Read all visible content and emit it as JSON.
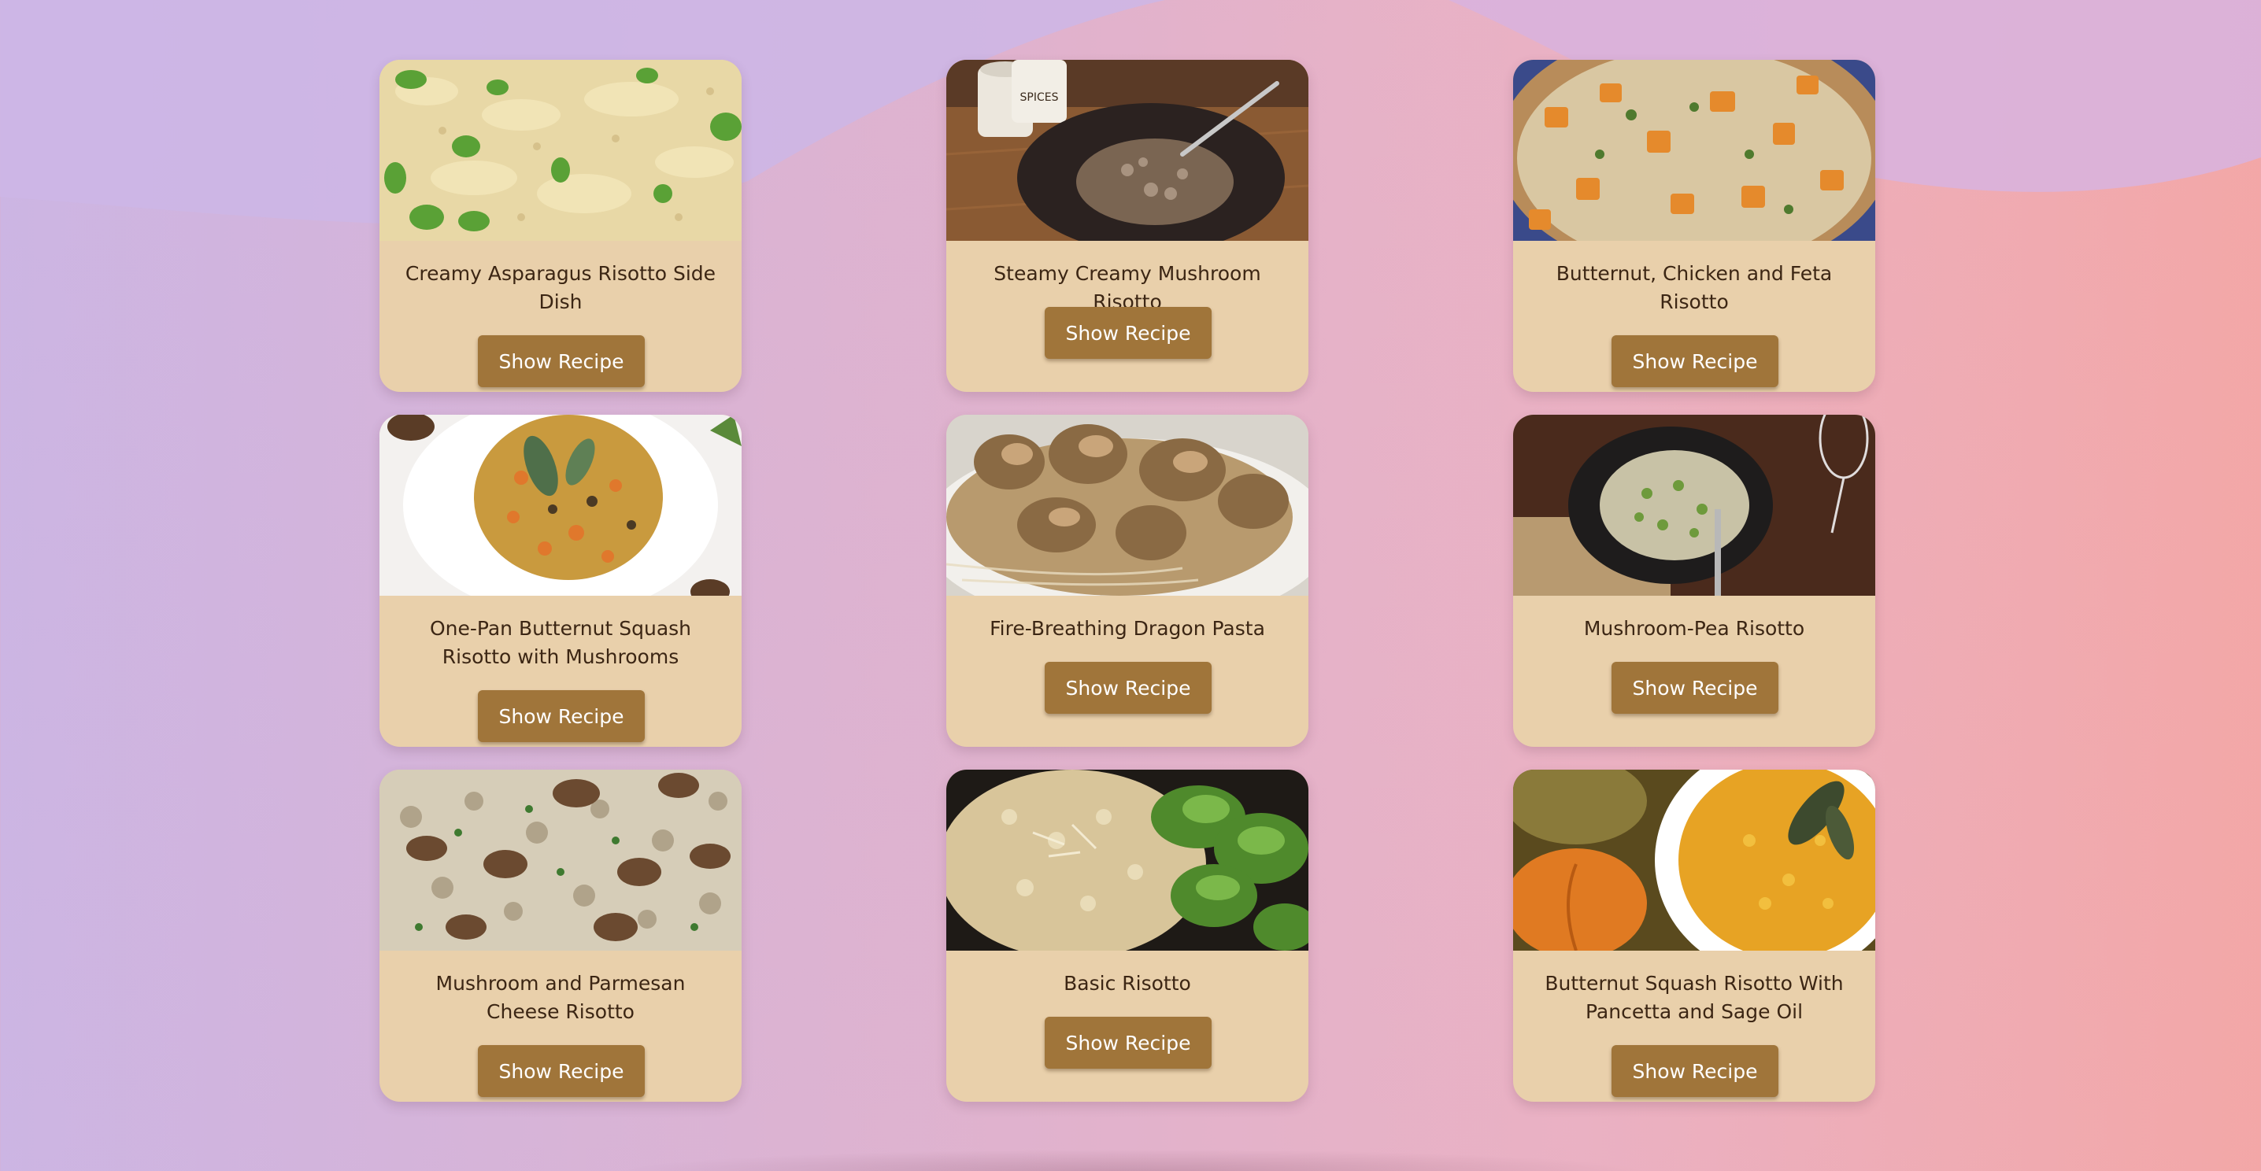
{
  "button_label": "Show Recipe",
  "recipes": [
    {
      "title": "Creamy Asparagus Risotto Side Dish"
    },
    {
      "title": "Steamy Creamy Mushroom Risotto"
    },
    {
      "title": "Butternut, Chicken and Feta Risotto"
    },
    {
      "title": "One-Pan Butternut Squash Risotto with Mushrooms"
    },
    {
      "title": "Fire-Breathing Dragon Pasta"
    },
    {
      "title": "Mushroom-Pea Risotto"
    },
    {
      "title": "Mushroom and Parmesan Cheese Risotto"
    },
    {
      "title": "Basic Risotto"
    },
    {
      "title": "Butternut Squash Risotto With Pancetta and Sage Oil"
    }
  ],
  "image_labels": [
    "SPICES"
  ]
}
